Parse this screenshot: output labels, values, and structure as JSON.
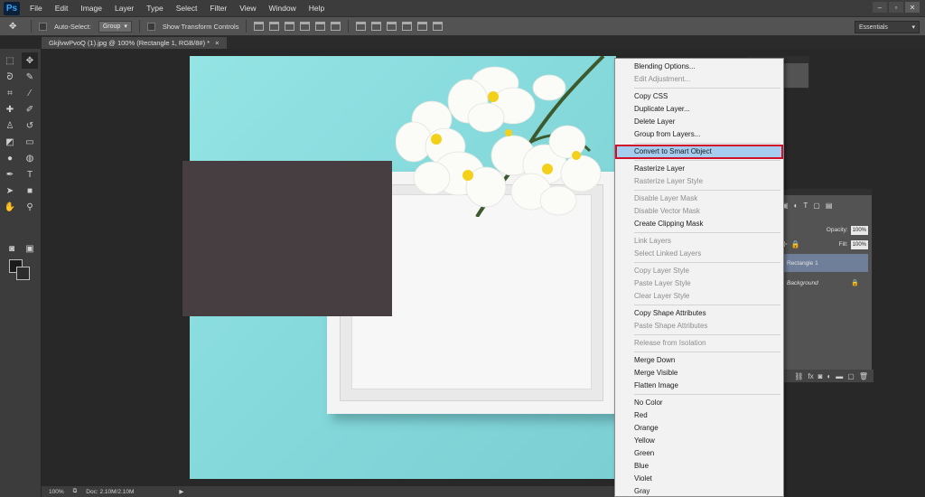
{
  "app": {
    "logo": "Ps"
  },
  "menu": [
    "File",
    "Edit",
    "Image",
    "Layer",
    "Type",
    "Select",
    "Filter",
    "View",
    "Window",
    "Help"
  ],
  "window_buttons": [
    "–",
    "▫",
    "✕"
  ],
  "options": {
    "auto_select_label": "Auto-Select:",
    "group_value": "Group",
    "transform_label": "Show Transform Controls",
    "workspace": "Essentials"
  },
  "document_tab": {
    "title": "GkjlvwPvoQ (1).jpg @ 100% (Rectangle 1, RGB/8#) *",
    "close": "×"
  },
  "status": {
    "zoom": "100%",
    "doc": "Doc: 2.10M/2.10M"
  },
  "layers": {
    "opacity_label": "Opacity:",
    "opacity_value": "100%",
    "fill_label": "Fill:",
    "fill_value": "100%",
    "items": [
      {
        "name": "Rectangle 1",
        "selected": true
      },
      {
        "name": "Background",
        "selected": false
      }
    ]
  },
  "context_menu": {
    "groups": [
      [
        {
          "label": "Blending Options...",
          "enabled": true
        },
        {
          "label": "Edit Adjustment...",
          "enabled": false
        }
      ],
      [
        {
          "label": "Copy CSS",
          "enabled": true
        },
        {
          "label": "Duplicate Layer...",
          "enabled": true
        },
        {
          "label": "Delete Layer",
          "enabled": true
        },
        {
          "label": "Group from Layers...",
          "enabled": true
        }
      ],
      [
        {
          "label": "Convert to Smart Object",
          "enabled": true,
          "highlighted": true
        }
      ],
      [
        {
          "label": "Rasterize Layer",
          "enabled": true
        },
        {
          "label": "Rasterize Layer Style",
          "enabled": false
        }
      ],
      [
        {
          "label": "Disable Layer Mask",
          "enabled": false
        },
        {
          "label": "Disable Vector Mask",
          "enabled": false
        },
        {
          "label": "Create Clipping Mask",
          "enabled": true
        }
      ],
      [
        {
          "label": "Link Layers",
          "enabled": false
        },
        {
          "label": "Select Linked Layers",
          "enabled": false
        }
      ],
      [
        {
          "label": "Copy Layer Style",
          "enabled": false
        },
        {
          "label": "Paste Layer Style",
          "enabled": false
        },
        {
          "label": "Clear Layer Style",
          "enabled": false
        }
      ],
      [
        {
          "label": "Copy Shape Attributes",
          "enabled": true
        },
        {
          "label": "Paste Shape Attributes",
          "enabled": false
        }
      ],
      [
        {
          "label": "Release from Isolation",
          "enabled": false
        }
      ],
      [
        {
          "label": "Merge Down",
          "enabled": true
        },
        {
          "label": "Merge Visible",
          "enabled": true
        },
        {
          "label": "Flatten Image",
          "enabled": true
        }
      ],
      [
        {
          "label": "No Color",
          "enabled": true
        },
        {
          "label": "Red",
          "enabled": true
        },
        {
          "label": "Orange",
          "enabled": true
        },
        {
          "label": "Yellow",
          "enabled": true
        },
        {
          "label": "Green",
          "enabled": true
        },
        {
          "label": "Blue",
          "enabled": true
        },
        {
          "label": "Violet",
          "enabled": true
        },
        {
          "label": "Gray",
          "enabled": true
        }
      ]
    ]
  },
  "colors": {
    "canvas_bg": "#8fdfe0",
    "frame": "#f4f4f4",
    "frame_inner": "#463e40",
    "highlight": "#a6cdf0",
    "highlight_border": "#d0102a",
    "selected_layer": "#6f7f99"
  }
}
